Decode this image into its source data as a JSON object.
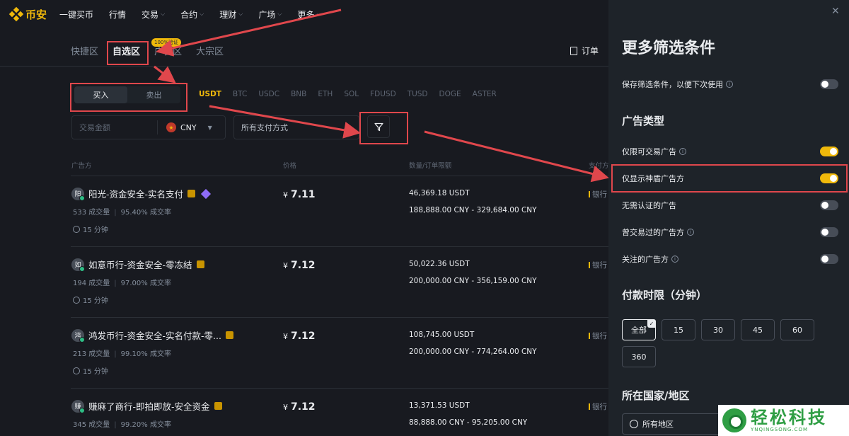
{
  "nav": {
    "logo_text": "币安",
    "items": [
      {
        "label": "一键买币",
        "has_chevron": false
      },
      {
        "label": "行情",
        "has_chevron": false
      },
      {
        "label": "交易",
        "has_chevron": true
      },
      {
        "label": "合约",
        "has_chevron": true
      },
      {
        "label": "理财",
        "has_chevron": true
      },
      {
        "label": "广场",
        "has_chevron": true
      },
      {
        "label": "更多",
        "has_chevron": true
      }
    ]
  },
  "zones": {
    "tabs": [
      "快捷区",
      "自选区",
      "广告区",
      "大宗区"
    ],
    "active_index": 1,
    "badge": "100%验证",
    "orders_label": "订单"
  },
  "trade": {
    "buy_label": "买入",
    "sell_label": "卖出",
    "active": "buy",
    "coins": [
      "USDT",
      "BTC",
      "USDC",
      "BNB",
      "ETH",
      "SOL",
      "FDUSD",
      "TUSD",
      "DOGE",
      "ASTER"
    ],
    "active_coin": "USDT"
  },
  "filters": {
    "amount_placeholder": "交易金额",
    "currency": "CNY",
    "payment": "所有支付方式"
  },
  "table": {
    "headers": {
      "advertiser": "广告方",
      "price": "价格",
      "quantity": "数量/订单限额",
      "payment": "支付方式"
    },
    "rows": [
      {
        "avatar": "阳",
        "name": "阳光-资金安全-实名支付",
        "trades": "533 成交量",
        "rate": "95.40% 成交率",
        "time": "15 分钟",
        "currency_symbol": "¥",
        "price": "7.11",
        "quantity": "46,369.18 USDT",
        "limit": "188,888.00 CNY - 329,684.00 CNY",
        "payment": "银行"
      },
      {
        "avatar": "如",
        "name": "如意币行-资金安全-零冻结",
        "trades": "194 成交量",
        "rate": "97.00% 成交率",
        "time": "15 分钟",
        "currency_symbol": "¥",
        "price": "7.12",
        "quantity": "50,022.36 USDT",
        "limit": "200,000.00 CNY - 356,159.00 CNY",
        "payment": "银行"
      },
      {
        "avatar": "鸿",
        "name": "鸿发币行-资金安全-实名付款-零...",
        "trades": "213 成交量",
        "rate": "99.10% 成交率",
        "time": "15 分钟",
        "currency_symbol": "¥",
        "price": "7.12",
        "quantity": "108,745.00 USDT",
        "limit": "200,000.00 CNY - 774,264.00 CNY",
        "payment": "银行"
      },
      {
        "avatar": "赚",
        "name": "赚麻了商行-即拍即放-安全资金",
        "trades": "345 成交量",
        "rate": "99.20% 成交率",
        "time": "15 分钟",
        "currency_symbol": "¥",
        "price": "7.12",
        "quantity": "13,371.53 USDT",
        "limit": "88,888.00 CNY - 95,205.00 CNY",
        "payment": "银行"
      }
    ]
  },
  "drawer": {
    "title": "更多筛选条件",
    "save_filters": {
      "label": "保存筛选条件，以便下次使用",
      "on": false
    },
    "ad_type_title": "广告类型",
    "ad_types": [
      {
        "label": "仅限可交易广告",
        "info": true,
        "on": true
      },
      {
        "label": "仅显示神盾广告方",
        "info": false,
        "on": true
      },
      {
        "label": "无需认证的广告",
        "info": false,
        "on": false
      },
      {
        "label": "曾交易过的广告方",
        "info": true,
        "on": false
      },
      {
        "label": "关注的广告方",
        "info": true,
        "on": false
      }
    ],
    "pay_time_title": "付款时限（分钟）",
    "pay_times": [
      "全部",
      "15",
      "30",
      "45",
      "60",
      "360"
    ],
    "pay_time_active": "全部",
    "region_title": "所在国家/地区",
    "region_value": "所有地区"
  },
  "watermark": {
    "main": "轻松科技",
    "sub": "YNQINGSONG.COM"
  },
  "colors": {
    "accent": "#f0b90b",
    "annotation": "#e0474c",
    "bg": "#181a20",
    "drawer_bg": "#1e2329"
  }
}
